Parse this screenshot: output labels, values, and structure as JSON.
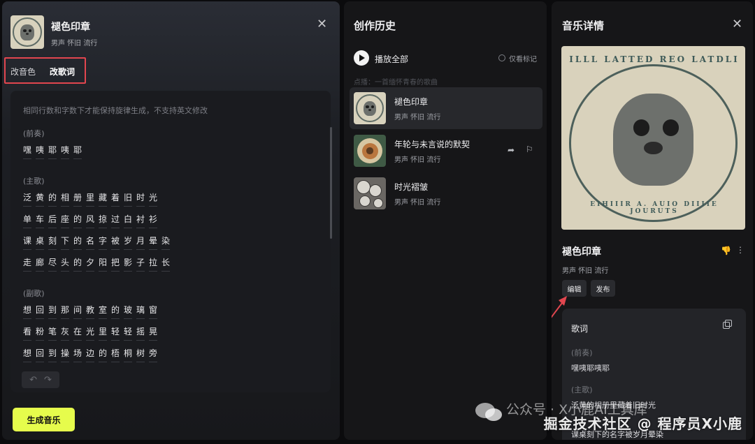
{
  "left_panel": {
    "song_title": "褪色印章",
    "song_tags": "男声 怀旧 流行",
    "tabs": [
      "改音色",
      "改歌词"
    ],
    "hint": "相同行数和字数下才能保持旋律生成，不支持英文修改",
    "sections": [
      {
        "label": "(前奏)",
        "lines": [
          "嘿咦耶咦耶"
        ]
      },
      {
        "label": "(主歌)",
        "lines": [
          "泛黄的相册里藏着旧时光",
          "单车后座的风掠过白衬衫",
          "课桌刻下的名字被岁月晕染",
          "走廊尽头的夕阳把影子拉长"
        ]
      },
      {
        "label": "(副歌)",
        "lines": [
          "想回到那间教室的玻璃窗",
          "看粉笔灰在光里轻轻摇晃",
          "想回到操场边的梧桐树旁"
        ]
      }
    ],
    "generate_label": "生成音乐"
  },
  "middle_panel": {
    "title": "创作历史",
    "play_all": "播放全部",
    "only_marked": "仅看标记",
    "prompt": "点播：一首缅怀青春的歌曲",
    "items": [
      {
        "title": "褪色印章",
        "tags": "男声 怀旧 流行"
      },
      {
        "title": "年轮与未言说的默契",
        "tags": "男声 怀旧 流行"
      },
      {
        "title": "时光褶皱",
        "tags": "男声 怀旧 流行"
      }
    ]
  },
  "right_panel": {
    "title": "音乐详情",
    "cover_text_top": "ILLL LATTED REO LATDLI",
    "cover_text_bottom": "EIHIIIR A. AUIO DIIIIE JOURUTS",
    "song_title": "褪色印章",
    "song_tags": "男声 怀旧 流行",
    "edit_label": "编辑",
    "publish_label": "发布",
    "lyrics_title": "歌词",
    "lyrics": [
      {
        "label": "(前奏)",
        "lines": [
          "嘿咦耶咦耶"
        ]
      },
      {
        "label": "(主歌)",
        "lines": [
          "泛黄的相册里藏着旧时光",
          "课桌刻下的名字被岁月晕染"
        ]
      }
    ]
  },
  "watermark": {
    "line1": "公众号 · X小鹿AI工具库",
    "line2": "掘金技术社区 @ 程序员X小鹿"
  },
  "colors": {
    "accent": "#e6fc4c",
    "highlight_box": "#e2464f"
  }
}
